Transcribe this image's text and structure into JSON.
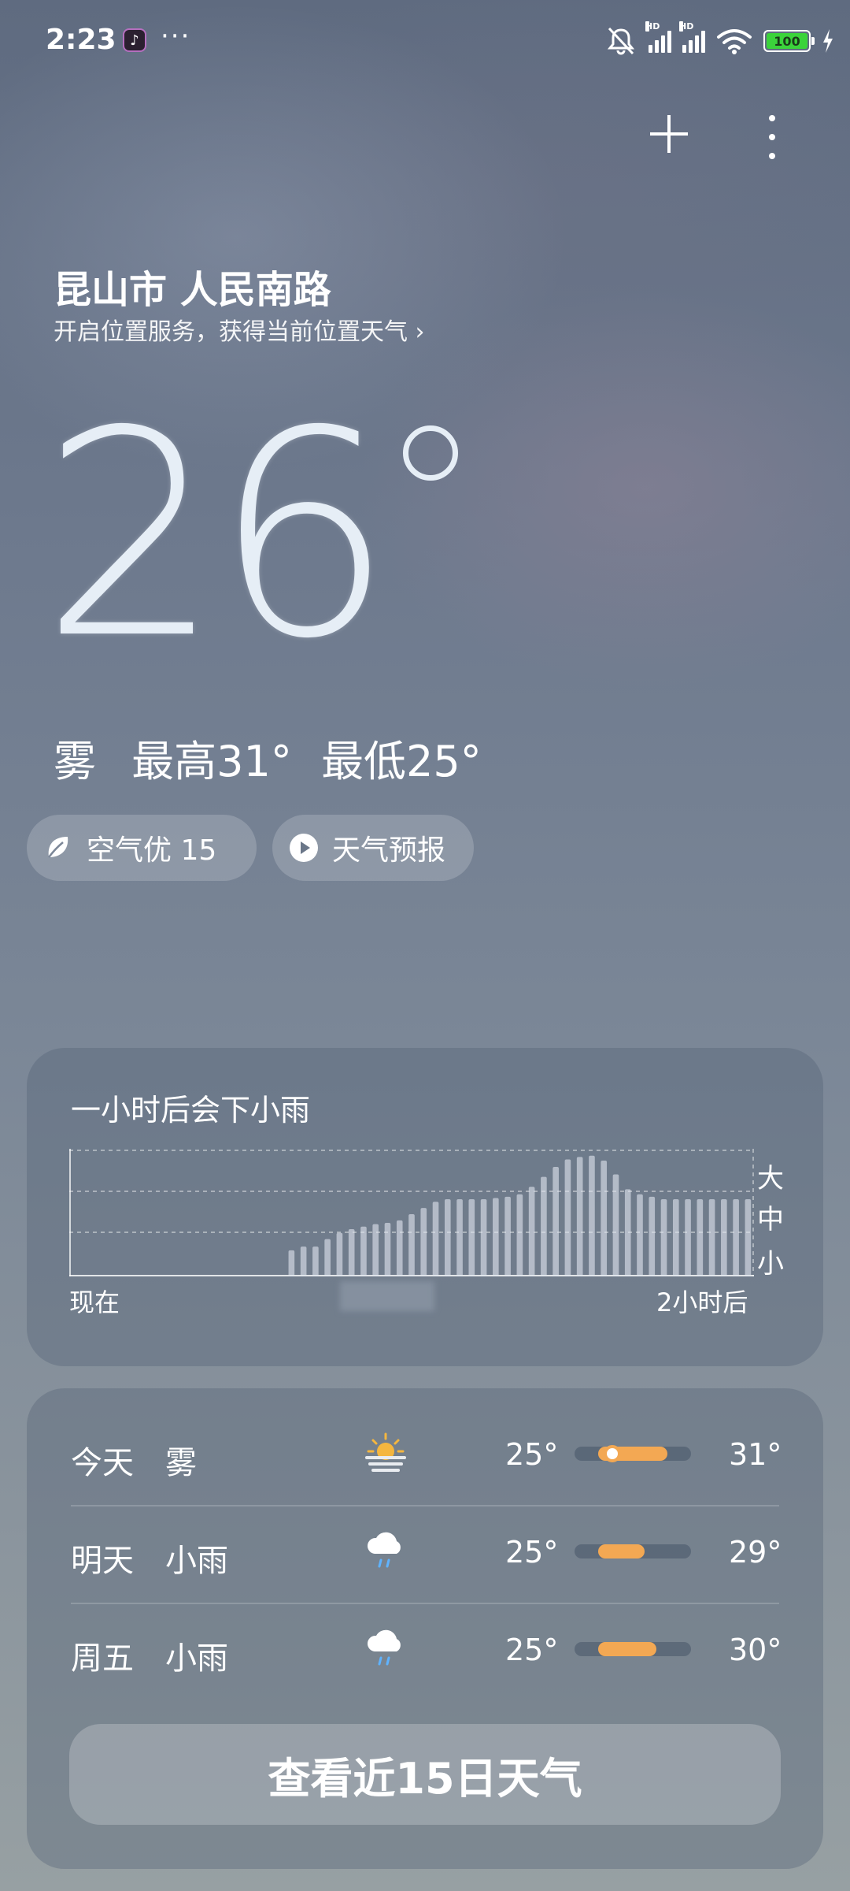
{
  "status_bar": {
    "time": "2:23",
    "dots": "···",
    "battery": "100"
  },
  "location": {
    "city": "昆山市 人民南路",
    "hint": "开启位置服务，获得当前位置天气 ›"
  },
  "current": {
    "temperature": "26",
    "condition": "雾",
    "high": "最高31°",
    "low": "最低25°"
  },
  "pills": {
    "air": "空气优 15",
    "forecast": "天气预报"
  },
  "rain": {
    "title": "一小时后会下小雨",
    "levels": [
      "大",
      "中",
      "小"
    ],
    "x_start": "现在",
    "x_end": "2小时后",
    "intensity": [
      0,
      0,
      0,
      0,
      0,
      0,
      0,
      0,
      0,
      0,
      0,
      0,
      0,
      0,
      0,
      0,
      0,
      0,
      0.21,
      0.24,
      0.24,
      0.3,
      0.35,
      0.38,
      0.4,
      0.42,
      0.43,
      0.45,
      0.5,
      0.55,
      0.6,
      0.62,
      0.62,
      0.62,
      0.62,
      0.63,
      0.64,
      0.66,
      0.72,
      0.8,
      0.88,
      0.94,
      0.96,
      0.97,
      0.93,
      0.82,
      0.7,
      0.66,
      0.64,
      0.62,
      0.62,
      0.62,
      0.62,
      0.62,
      0.62,
      0.62,
      0.62
    ]
  },
  "forecast": [
    {
      "day": "今天",
      "cond": "雾",
      "icon": "fog-icon",
      "low": "25°",
      "high": "31°",
      "low_val": 25,
      "high_val": 31,
      "current": 26
    },
    {
      "day": "明天",
      "cond": "小雨",
      "icon": "light-rain-icon",
      "low": "25°",
      "high": "29°",
      "low_val": 25,
      "high_val": 29
    },
    {
      "day": "周五",
      "cond": "小雨",
      "icon": "light-rain-icon",
      "low": "25°",
      "high": "30°",
      "low_val": 25,
      "high_val": 30
    }
  ],
  "forecast_range": [
    23,
    33
  ],
  "button_15day": "查看近15日天气"
}
